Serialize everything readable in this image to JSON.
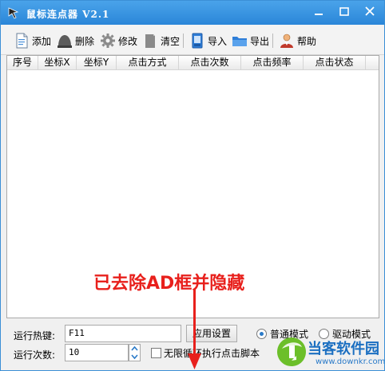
{
  "window": {
    "title": "鼠标连点器 V2.1",
    "title_bar_color": "#2f8ddc"
  },
  "toolbar": {
    "items": [
      {
        "label": "添加",
        "icon": "add-document-icon"
      },
      {
        "label": "删除",
        "icon": "delete-icon"
      },
      {
        "label": "修改",
        "icon": "gear-icon"
      },
      {
        "label": "清空",
        "icon": "clear-icon"
      },
      {
        "label": "导入",
        "icon": "import-icon"
      },
      {
        "label": "导出",
        "icon": "export-folder-icon"
      },
      {
        "label": "帮助",
        "icon": "help-user-icon"
      }
    ]
  },
  "list": {
    "columns": [
      "序号",
      "坐标X",
      "坐标Y",
      "点击方式",
      "点击次数",
      "点击频率",
      "点击状态"
    ],
    "rows": []
  },
  "settings": {
    "hotkey_label": "运行热键:",
    "hotkey_value": "F11",
    "apply_button": "应用设置",
    "count_label": "运行次数:",
    "count_value": "10",
    "loop_label": "无限循环执行点击脚本",
    "loop_checked": false,
    "mode_normal": "普通模式",
    "mode_driver": "驱动模式",
    "mode_selected": "普通模式"
  },
  "annotation": {
    "text": "已去除AD框并隐藏",
    "color": "#e8201c"
  },
  "watermark": {
    "name": "当客软件园",
    "url": "www.downkr.com"
  }
}
